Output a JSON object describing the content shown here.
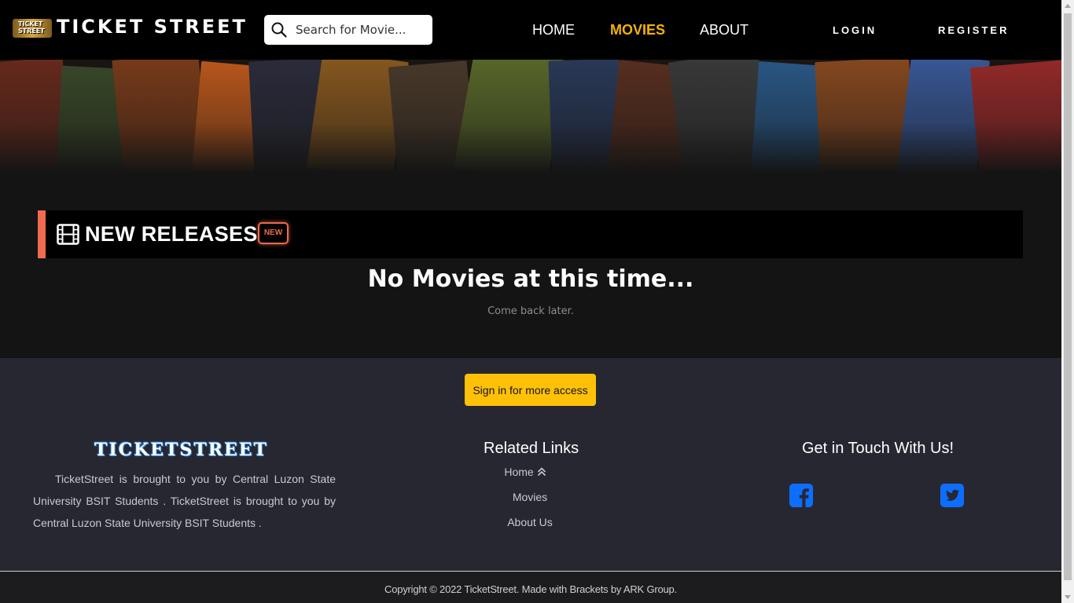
{
  "app": {
    "logo_text": "TICKET STREET",
    "logo_badge": "TICKET STREET"
  },
  "search": {
    "placeholder": "Search for Movie...",
    "icon": "search-icon"
  },
  "nav": {
    "items": [
      {
        "label": "HOME",
        "active": false
      },
      {
        "label": "MOVIES",
        "active": true
      },
      {
        "label": "ABOUT",
        "active": false
      }
    ],
    "login": "LOGIN",
    "register": "REGISTER",
    "active_color": "#f5b301"
  },
  "section": {
    "title": "NEW RELEASES",
    "badge": "NEW",
    "icon": "film-icon",
    "accent_color": "#f06a4f"
  },
  "empty_state": {
    "title": "No Movies at this time...",
    "subtitle": "Come back later."
  },
  "footer": {
    "signin_button": "Sign in for more access",
    "brand": "TICKETSTREET",
    "description": "TicketStreet is brought to you by Central Luzon State University BSIT Students . TicketStreet is brought to you by Central Luzon State University BSIT Students .",
    "related_links": {
      "heading": "Related Links",
      "items": [
        {
          "label": "Home",
          "icon": "chevron-double-up-icon"
        },
        {
          "label": "Movies"
        },
        {
          "label": "About Us"
        }
      ]
    },
    "contact": {
      "heading": "Get in Touch With Us!",
      "socials": [
        "facebook-icon",
        "twitter-icon"
      ],
      "icon_color": "#0d6efd"
    },
    "button_color": "#ffc107",
    "copyright": "Copyright © 2022 TicketStreet. Made with Brackets by ARK Group."
  }
}
